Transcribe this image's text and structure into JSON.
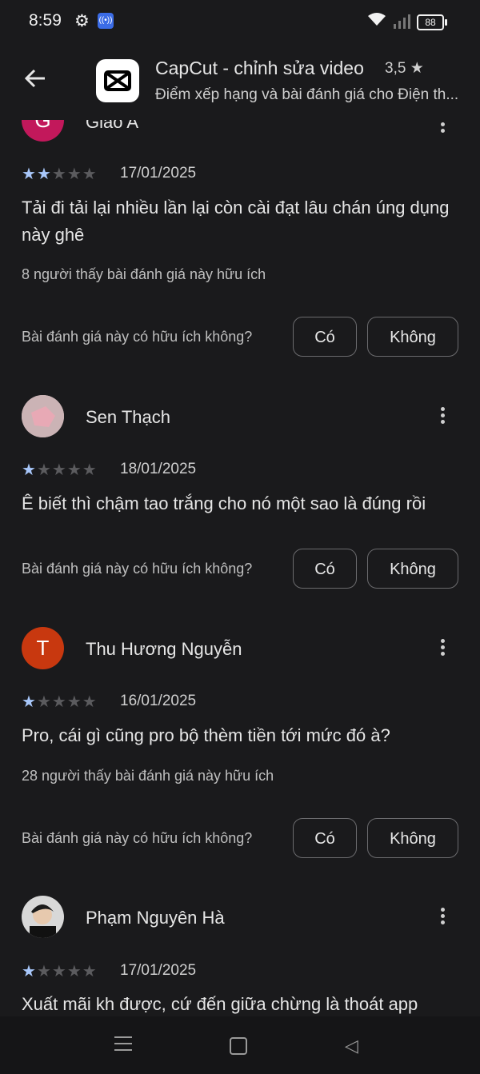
{
  "status": {
    "time": "8:59",
    "battery": "88"
  },
  "app": {
    "title": "CapCut - chỉnh sửa video",
    "rating": "3,5",
    "subtitle": "Điểm xếp hạng và bài đánh giá cho Điện th...",
    "back_icon": "arrow-left-icon"
  },
  "reviews": [
    {
      "name": "Giao A",
      "avatar_letter": "G",
      "avatar_color": "#c2185b",
      "stars": 2,
      "date": "17/01/2025",
      "text": "Tải đi tải lại nhiều lần lại còn cài đạt lâu chán úng dụng này ghê",
      "helpful": "8 người thấy bài đánh giá này hữu ích",
      "question": "Bài đánh giá này có hữu ích không?",
      "yes": "Có",
      "no": "Không"
    },
    {
      "name": "Sen Thạch",
      "avatar_letter": "",
      "avatar_color": "#c9a9ad",
      "stars": 1,
      "date": "18/01/2025",
      "text": "Ê biết thì chậm tao trắng cho nó một sao là đúng rồi",
      "helpful": "",
      "question": "Bài đánh giá này có hữu ích không?",
      "yes": "Có",
      "no": "Không"
    },
    {
      "name": "Thu Hương Nguyễn",
      "avatar_letter": "T",
      "avatar_color": "#c8380f",
      "stars": 1,
      "date": "16/01/2025",
      "text": "Pro, cái gì cũng pro bộ thèm tiền tới mức đó à?",
      "helpful": "28 người thấy bài đánh giá này hữu ích",
      "question": "Bài đánh giá này có hữu ích không?",
      "yes": "Có",
      "no": "Không"
    },
    {
      "name": "Phạm Nguyên Hà",
      "avatar_letter": "",
      "avatar_color": "#3a3a3a",
      "stars": 1,
      "date": "17/01/2025",
      "text": "Xuất mãi kh được, cứ đến giữa chừng là thoát app",
      "helpful": "",
      "question": "",
      "yes": "",
      "no": ""
    }
  ]
}
